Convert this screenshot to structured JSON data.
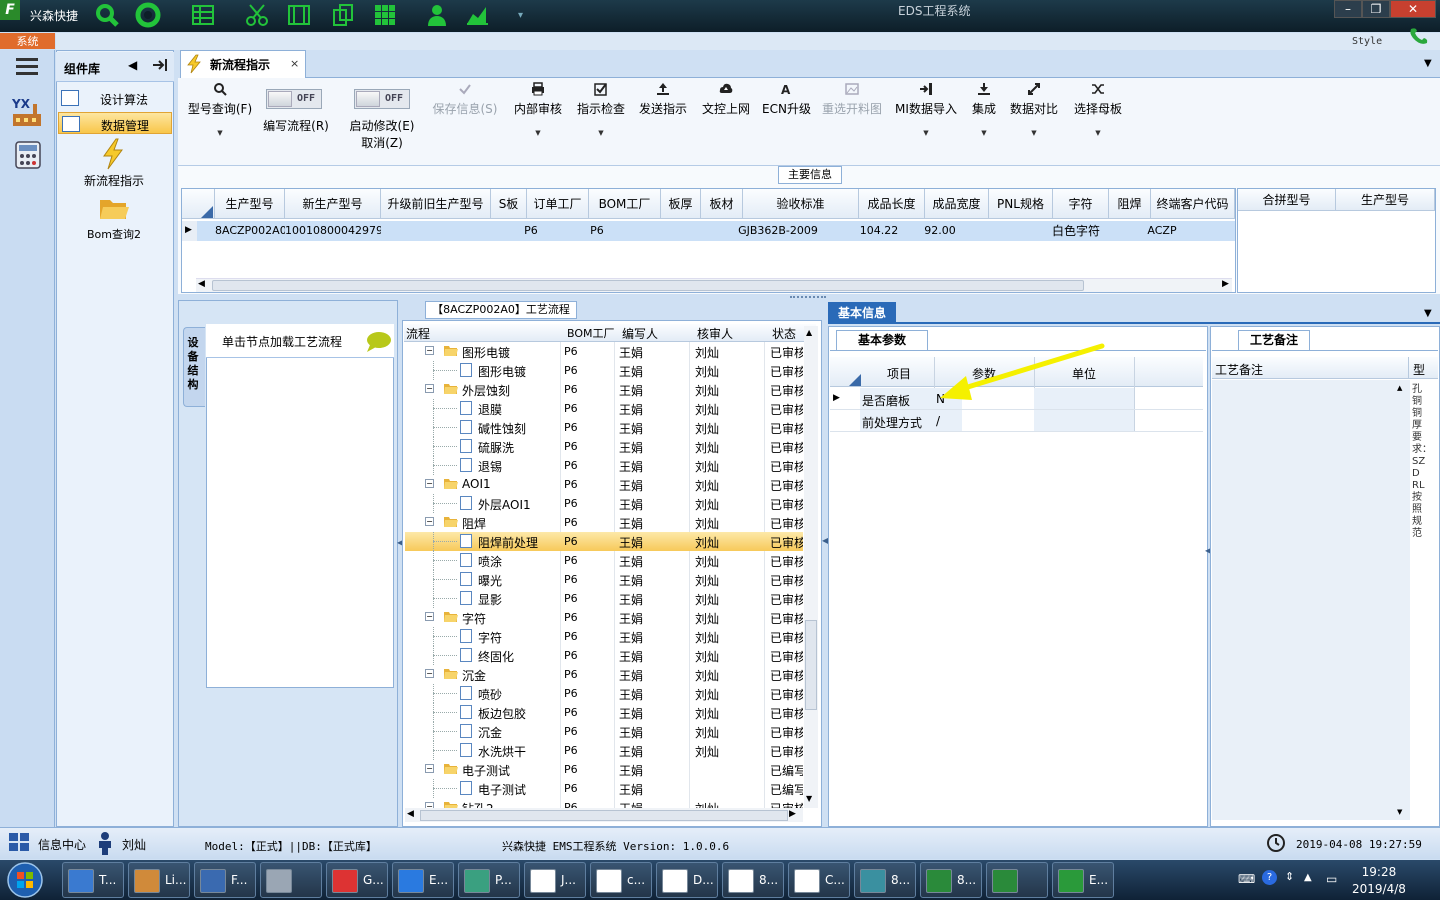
{
  "titlebar": {
    "app_title": "兴森快捷",
    "window_title": "EDS工程系统",
    "style_label": "Style",
    "system_tab": "系统",
    "app_icon_letter": "F"
  },
  "sidebar": {
    "title": "组件库",
    "items": [
      {
        "label": "设计算法"
      },
      {
        "label": "数据管理"
      }
    ],
    "tiles": [
      {
        "label": "新流程指示"
      },
      {
        "label": "Bom查询2"
      }
    ]
  },
  "doc_tab": {
    "label": "新流程指示",
    "close": "×"
  },
  "toolbar": {
    "buttons": [
      {
        "label": "型号查询(F)"
      },
      {
        "label": "保存信息(S)"
      },
      {
        "label": "内部审核"
      },
      {
        "label": "指示检查"
      },
      {
        "label": "发送指示"
      },
      {
        "label": "文控上网"
      },
      {
        "label": "ECN升级"
      },
      {
        "label": "重选开料图"
      },
      {
        "label": "MI数据导入"
      },
      {
        "label": "集成"
      },
      {
        "label": "数据对比"
      },
      {
        "label": "选择母板"
      }
    ],
    "toggles": [
      {
        "state": "OFF",
        "label": "编写流程(R)"
      },
      {
        "state": "OFF",
        "label": "启动修改(E)",
        "label2": "取消(Z)"
      }
    ]
  },
  "main_info": {
    "label": "主要信息",
    "columns": [
      "生产型号",
      "新生产型号",
      "升级前旧生产型号",
      "S板",
      "订单工厂",
      "BOM工厂",
      "板厚",
      "板材",
      "验收标准",
      "成品长度",
      "成品宽度",
      "PNL规格",
      "字符",
      "阻焊",
      "终端客户代码"
    ],
    "rows": [
      [
        "8ACZP002A0",
        "10010800042979",
        "",
        "",
        "P6",
        "P6",
        "",
        "",
        "GJB362B-2009",
        "104.22",
        "92.00",
        "",
        "白色字符",
        "",
        "ACZP"
      ]
    ],
    "side_columns": [
      "合拼型号",
      "生产型号"
    ]
  },
  "equipment": {
    "vertical_tab": "设备结构",
    "hint": "单击节点加载工艺流程"
  },
  "flow": {
    "tab_label": "【8ACZP002A0】工艺流程",
    "columns": [
      "流程",
      "BOM工厂",
      "编写人",
      "核审人",
      "状态"
    ],
    "rows": [
      {
        "name": "图形电镀",
        "level": 0,
        "bom": "P6",
        "writer": "王娟",
        "reviewer": "刘灿",
        "status": "已审核"
      },
      {
        "name": "图形电镀",
        "level": 1,
        "bom": "P6",
        "writer": "王娟",
        "reviewer": "刘灿",
        "status": "已审核"
      },
      {
        "name": "外层蚀刻",
        "level": 0,
        "bom": "P6",
        "writer": "王娟",
        "reviewer": "刘灿",
        "status": "已审核"
      },
      {
        "name": "退膜",
        "level": 1,
        "bom": "P6",
        "writer": "王娟",
        "reviewer": "刘灿",
        "status": "已审核"
      },
      {
        "name": "碱性蚀刻",
        "level": 1,
        "bom": "P6",
        "writer": "王娟",
        "reviewer": "刘灿",
        "status": "已审核"
      },
      {
        "name": "硫脲洗",
        "level": 1,
        "bom": "P6",
        "writer": "王娟",
        "reviewer": "刘灿",
        "status": "已审核"
      },
      {
        "name": "退锡",
        "level": 1,
        "bom": "P6",
        "writer": "王娟",
        "reviewer": "刘灿",
        "status": "已审核"
      },
      {
        "name": "AOI1",
        "level": 0,
        "bom": "P6",
        "writer": "王娟",
        "reviewer": "刘灿",
        "status": "已审核"
      },
      {
        "name": "外层AOI1",
        "level": 1,
        "bom": "P6",
        "writer": "王娟",
        "reviewer": "刘灿",
        "status": "已审核"
      },
      {
        "name": "阻焊",
        "level": 0,
        "bom": "P6",
        "writer": "王娟",
        "reviewer": "刘灿",
        "status": "已审核"
      },
      {
        "name": "阻焊前处理",
        "level": 1,
        "bom": "P6",
        "writer": "王娟",
        "reviewer": "刘灿",
        "status": "已审核",
        "selected": true
      },
      {
        "name": "喷涂",
        "level": 1,
        "bom": "P6",
        "writer": "王娟",
        "reviewer": "刘灿",
        "status": "已审核"
      },
      {
        "name": "曝光",
        "level": 1,
        "bom": "P6",
        "writer": "王娟",
        "reviewer": "刘灿",
        "status": "已审核"
      },
      {
        "name": "显影",
        "level": 1,
        "bom": "P6",
        "writer": "王娟",
        "reviewer": "刘灿",
        "status": "已审核"
      },
      {
        "name": "字符",
        "level": 0,
        "bom": "P6",
        "writer": "王娟",
        "reviewer": "刘灿",
        "status": "已审核"
      },
      {
        "name": "字符",
        "level": 1,
        "bom": "P6",
        "writer": "王娟",
        "reviewer": "刘灿",
        "status": "已审核"
      },
      {
        "name": "终固化",
        "level": 1,
        "bom": "P6",
        "writer": "王娟",
        "reviewer": "刘灿",
        "status": "已审核"
      },
      {
        "name": "沉金",
        "level": 0,
        "bom": "P6",
        "writer": "王娟",
        "reviewer": "刘灿",
        "status": "已审核"
      },
      {
        "name": "喷砂",
        "level": 1,
        "bom": "P6",
        "writer": "王娟",
        "reviewer": "刘灿",
        "status": "已审核"
      },
      {
        "name": "板边包胶",
        "level": 1,
        "bom": "P6",
        "writer": "王娟",
        "reviewer": "刘灿",
        "status": "已审核"
      },
      {
        "name": "沉金",
        "level": 1,
        "bom": "P6",
        "writer": "王娟",
        "reviewer": "刘灿",
        "status": "已审核"
      },
      {
        "name": "水洗烘干",
        "level": 1,
        "bom": "P6",
        "writer": "王娟",
        "reviewer": "刘灿",
        "status": "已审核"
      },
      {
        "name": "电子测试",
        "level": 0,
        "bom": "P6",
        "writer": "王娟",
        "reviewer": "",
        "status": "已编写"
      },
      {
        "name": "电子测试",
        "level": 1,
        "bom": "P6",
        "writer": "王娟",
        "reviewer": "",
        "status": "已编写"
      },
      {
        "name": "钻孔2",
        "level": 0,
        "bom": "P6",
        "writer": "王娟",
        "reviewer": "刘灿",
        "status": "已审核"
      }
    ]
  },
  "basic_info": {
    "tab_label": "基本信息",
    "sub_tab": "基本参数",
    "columns": [
      "项目",
      "参数",
      "单位"
    ],
    "rows": [
      {
        "item": "是否磨板",
        "value": "N",
        "unit": ""
      },
      {
        "item": "前处理方式",
        "value": "/",
        "unit": ""
      }
    ]
  },
  "process_note": {
    "tab_label": "工艺备注",
    "column": "工艺备注",
    "column2": "型",
    "vertical_text": "孔铜铜厚要求：SZDRL按照规范"
  },
  "statusbar": {
    "center": "信息中心",
    "user": "刘灿",
    "model_db": "Model:【正式】||DB:【正式库】",
    "version": "兴森快捷 EMS工程系统 Version: 1.0.0.6",
    "datetime": "2019-04-08 19:27:59"
  },
  "taskbar": {
    "tasks": [
      {
        "label": "T..."
      },
      {
        "label": "Li..."
      },
      {
        "label": "F..."
      },
      {
        "label": ""
      },
      {
        "label": "G..."
      },
      {
        "label": "E..."
      },
      {
        "label": "P..."
      },
      {
        "label": "J..."
      },
      {
        "label": "c..."
      },
      {
        "label": "D..."
      },
      {
        "label": "8..."
      },
      {
        "label": "C..."
      },
      {
        "label": "8..."
      },
      {
        "label": "8..."
      },
      {
        "label": ""
      },
      {
        "label": "E..."
      }
    ],
    "time": "19:28",
    "date": "2019/4/8"
  },
  "colors": {
    "accent": "#2a6ab8",
    "selection": "#f7c95a",
    "arrow": "#f5f000"
  }
}
